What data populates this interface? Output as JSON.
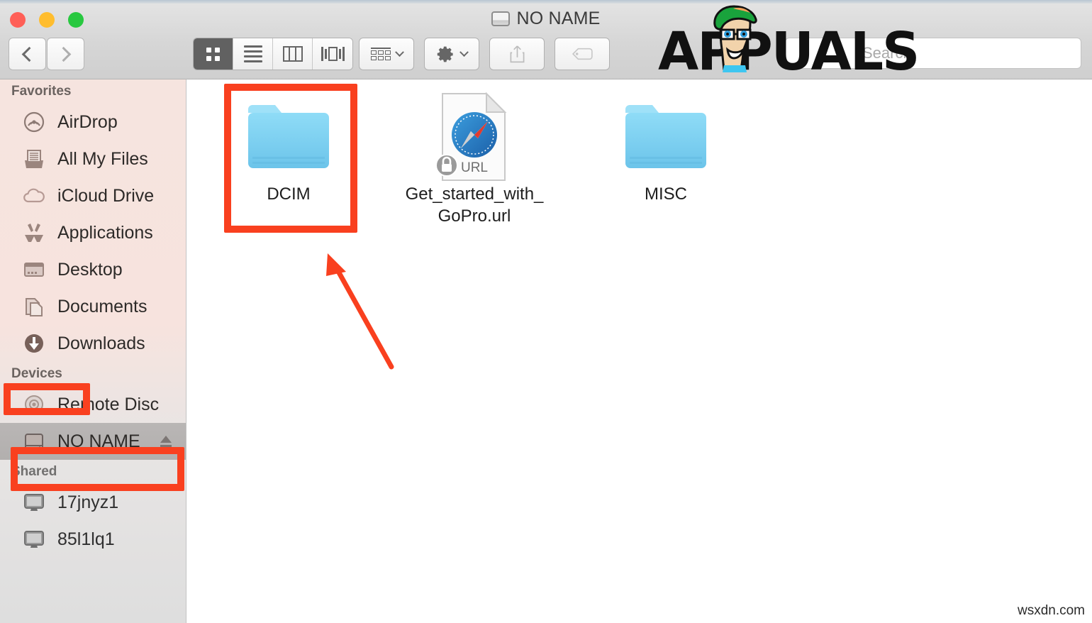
{
  "window": {
    "title": "NO NAME",
    "title_icon": "external-drive-icon",
    "traffic_lights": {
      "close": "close-window-button",
      "minimize": "minimize-window-button",
      "maximize": "maximize-window-button"
    }
  },
  "toolbar": {
    "back_label": "Back",
    "forward_label": "Forward",
    "view_modes": [
      {
        "name": "icon-view",
        "label": "Icon View",
        "active": true
      },
      {
        "name": "list-view",
        "label": "List View",
        "active": false
      },
      {
        "name": "column-view",
        "label": "Column View",
        "active": false
      },
      {
        "name": "coverflow-view",
        "label": "Cover Flow View",
        "active": false
      }
    ],
    "arrange_label": "Arrange",
    "action_label": "Action",
    "share_label": "Share",
    "tags_label": "Edit Tags"
  },
  "search": {
    "placeholder": "Search",
    "value": ""
  },
  "sidebar": {
    "sections": [
      {
        "header": "Favorites",
        "items": [
          {
            "label": "AirDrop",
            "icon": "airdrop-icon",
            "selected": false
          },
          {
            "label": "All My Files",
            "icon": "all-my-files-icon",
            "selected": false
          },
          {
            "label": "iCloud Drive",
            "icon": "icloud-drive-icon",
            "selected": false
          },
          {
            "label": "Applications",
            "icon": "applications-icon",
            "selected": false
          },
          {
            "label": "Desktop",
            "icon": "desktop-icon",
            "selected": false
          },
          {
            "label": "Documents",
            "icon": "documents-icon",
            "selected": false
          },
          {
            "label": "Downloads",
            "icon": "downloads-icon",
            "selected": false
          }
        ]
      },
      {
        "header": "Devices",
        "items": [
          {
            "label": "Remote Disc",
            "icon": "optical-disc-icon",
            "selected": false
          },
          {
            "label": "NO NAME",
            "icon": "external-drive-icon",
            "selected": true,
            "eject": "eject-icon"
          }
        ]
      },
      {
        "header": "Shared",
        "items": [
          {
            "label": "17jnyz1",
            "icon": "computer-icon",
            "selected": false
          },
          {
            "label": "85l1lq1",
            "icon": "computer-icon",
            "selected": false
          }
        ]
      }
    ]
  },
  "content": {
    "items": [
      {
        "name": "DCIM",
        "type": "folder",
        "icon": "blue-folder-icon",
        "highlighted": true
      },
      {
        "name": "Get_started_with_GoPro.url",
        "type": "url-file",
        "icon": "safari-url-document-icon",
        "badge": "lock-badge-icon",
        "badge_label": "URL",
        "highlighted": false
      },
      {
        "name": "MISC",
        "type": "folder",
        "icon": "blue-folder-icon",
        "highlighted": false
      }
    ]
  },
  "annotations": {
    "color": "#f9401f",
    "boxes": [
      {
        "target": "DCIM",
        "name": "annotation-box-dcim"
      },
      {
        "target": "Devices",
        "name": "annotation-box-devices"
      },
      {
        "target": "NO NAME",
        "name": "annotation-box-no-name"
      }
    ],
    "arrow": {
      "name": "annotation-arrow",
      "points_to": "DCIM"
    }
  },
  "watermarks": {
    "brand": "APPUALS",
    "brand_mascot": "appuals-mascot-icon",
    "site": "wsxdn.com"
  },
  "colors": {
    "accent_red": "#f9401f",
    "folder_blue": "#6ec8f0",
    "traffic_red": "#ff5f57",
    "traffic_yellow": "#ffbd2e",
    "traffic_green": "#28c840",
    "sidebar_tint": "#f7e3de",
    "selection_gray": "#b5b2b1"
  }
}
